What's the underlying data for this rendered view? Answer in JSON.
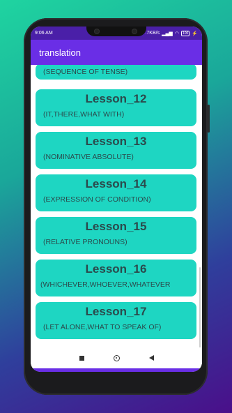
{
  "status": {
    "time": "9:06 AM",
    "speed": ".7KB/s",
    "battery": "100"
  },
  "appbar": {
    "title": "translation"
  },
  "lessons": [
    {
      "title": "",
      "subtitle": "(SEQUENCE OF TENSE)"
    },
    {
      "title": "Lesson_12",
      "subtitle": "(IT,THERE,WHAT WITH)"
    },
    {
      "title": "Lesson_13",
      "subtitle": "(NOMINATIVE ABSOLUTE)"
    },
    {
      "title": "Lesson_14",
      "subtitle": "(EXPRESSION OF CONDITION)"
    },
    {
      "title": "Lesson_15",
      "subtitle": "(RELATIVE PRONOUNS)"
    },
    {
      "title": "Lesson_16",
      "subtitle": "(WHICHEVER,WHOEVER,WHATEVER"
    },
    {
      "title": "Lesson_17",
      "subtitle": "(LET ALONE,WHAT TO SPEAK OF)"
    }
  ],
  "colors": {
    "appbar": "#6a2ee6",
    "statusbar": "#4a1fa8",
    "card": "#1ed6c2",
    "card_text": "#2b4a4c"
  },
  "icons": {
    "nav_recents": "square-icon",
    "nav_home": "circle-icon",
    "nav_back": "back-triangle-icon"
  }
}
